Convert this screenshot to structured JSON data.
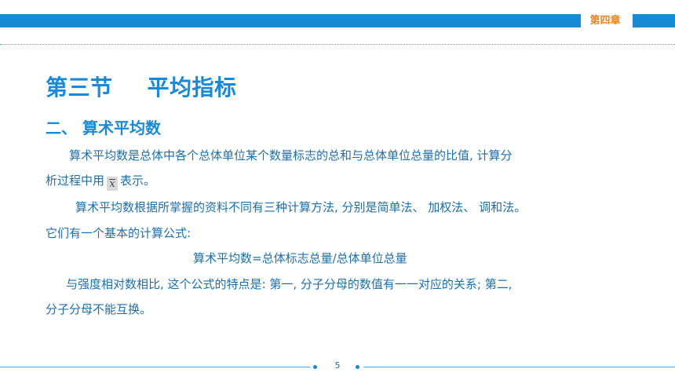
{
  "header": {
    "chapter": "第四章"
  },
  "section_title": {
    "part1": "第三节",
    "part2": "平均指标"
  },
  "subtitle": "二、 算术平均数",
  "paragraphs": {
    "p1_line1": "算术平均数是总体中各个总体单位某个数量标志的总和与总体单位总量的比值, 计算分",
    "p1_line2_before": "析过程中用",
    "p1_symbol": "x",
    "p1_line2_after": "表示。",
    "p2_line1": "算术平均数根据所掌握的资料不同有三种计算方法, 分别是简单法、 加权法、 调和法。",
    "p2_line2": "它们有一个基本的计算公式:",
    "formula": "算术平均数=总体标志总量/总体单位总量",
    "p3_line1": "与强度相对数相比, 这个公式的特点是: 第一, 分子分母的数值有一一对应的关系; 第二,",
    "p3_line2": "分子分母不能互换。"
  },
  "footer": {
    "page_number": "5"
  },
  "colors": {
    "accent_blue": "#1a8ad6",
    "text_blue": "#1d6fa8",
    "chapter_orange": "#f0821e"
  }
}
